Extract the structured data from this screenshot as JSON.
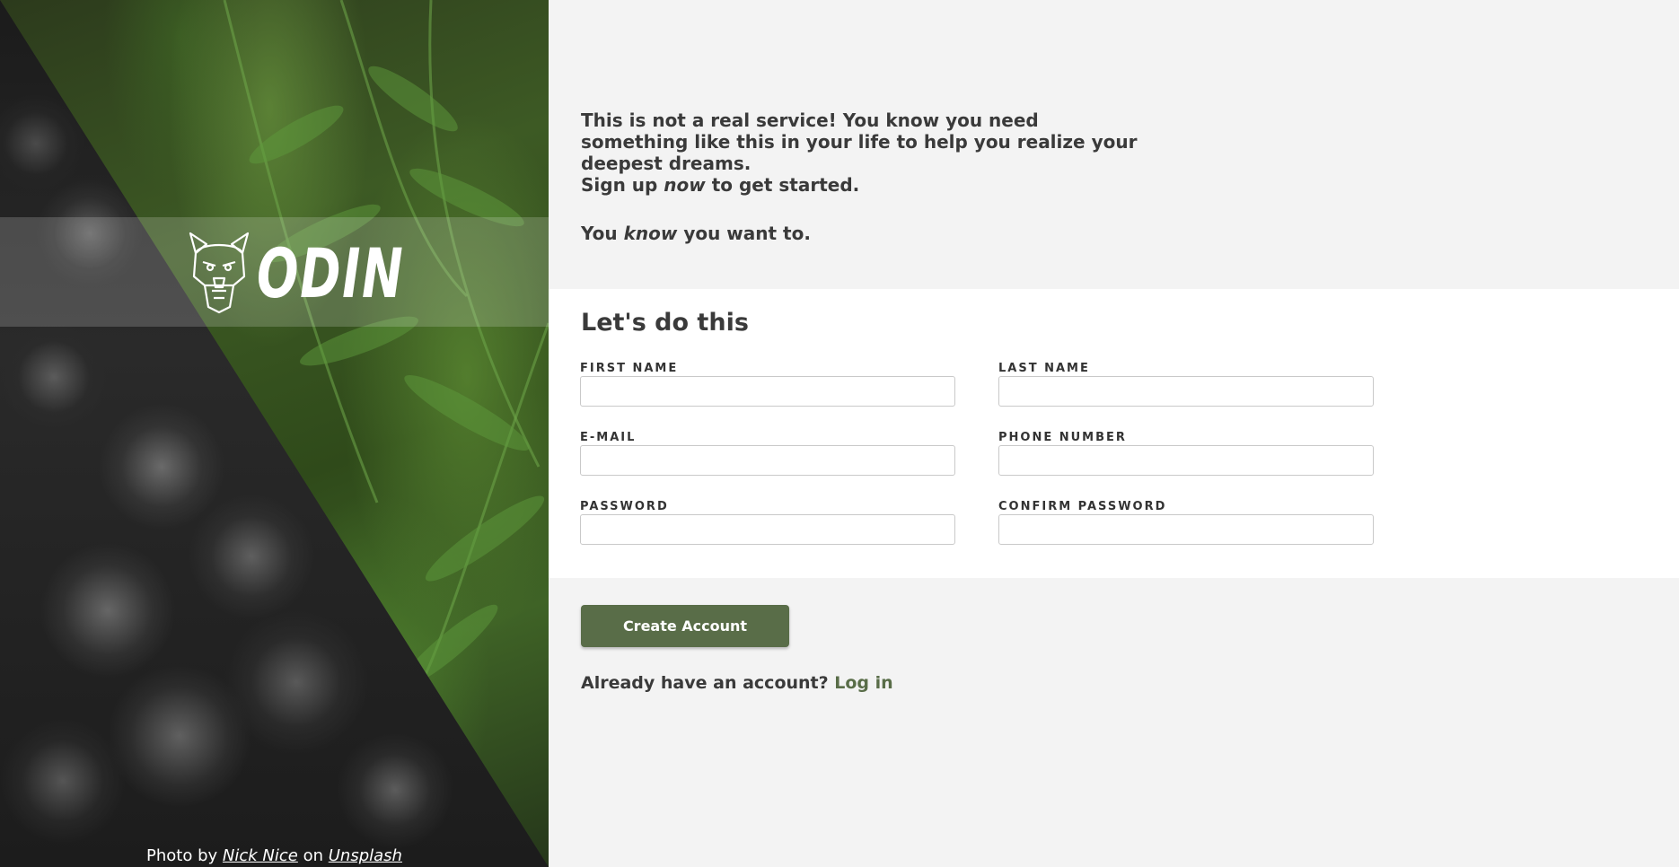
{
  "branding": {
    "logo_text": "ODIN"
  },
  "photo_credit": {
    "prefix": "Photo by ",
    "author": "Nick Nice",
    "middle": " on ",
    "site": "Unsplash"
  },
  "intro": {
    "line1": "This is not a real service! You know you need something like this in your life to help you realize your deepest dreams.",
    "line2_before": "Sign up ",
    "line2_em": "now",
    "line2_after": " to get started.",
    "line3_before": "You ",
    "line3_em": "know",
    "line3_after": " you want to."
  },
  "form": {
    "title": "Let's do this",
    "fields": {
      "first_name": {
        "label": "FIRST NAME",
        "value": ""
      },
      "last_name": {
        "label": "LAST NAME",
        "value": ""
      },
      "email": {
        "label": "E-MAIL",
        "value": ""
      },
      "phone": {
        "label": "PHONE NUMBER",
        "value": ""
      },
      "password": {
        "label": "PASSWORD",
        "value": ""
      },
      "confirm_password": {
        "label": "CONFIRM PASSWORD",
        "value": ""
      }
    }
  },
  "actions": {
    "create_label": "Create Account",
    "login_prompt": "Already have an account? ",
    "login_link": "Log in"
  },
  "colors": {
    "accent": "#596d48",
    "panel_bg": "#f3f3f3",
    "form_bg": "#ffffff",
    "text": "#3a3a3a"
  }
}
